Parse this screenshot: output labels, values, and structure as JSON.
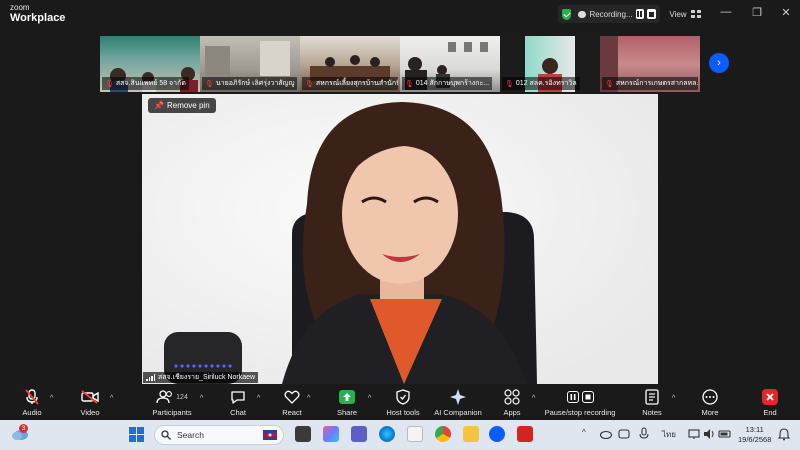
{
  "brand": {
    "line1": "zoom",
    "line2": "Workplace"
  },
  "recording": {
    "label": "Recording..."
  },
  "view": {
    "label": "View"
  },
  "thumbnails": [
    {
      "name": "สสจ.สินแพทย์ 58 จากัด"
    },
    {
      "name": "นายอภิรักษ์ เลิศรุ่งวาสัญญู"
    },
    {
      "name": "สหกรณ์เลี้ยงสุกรบ้านสำนักนี..."
    },
    {
      "name": "014 สักกาษบุพกร้างกะ..."
    },
    {
      "name": "012 สลค.รอิงทราวิล"
    },
    {
      "name": "สหกรณ์การเกษตรสากลหล..."
    }
  ],
  "main": {
    "remove_pin": "Remove pin",
    "speaker_name": "สสจ.เชียงราย_Siriluck Norkaew"
  },
  "toolbar": {
    "audio": "Audio",
    "video": "Video",
    "participants": "Participants",
    "participants_count": "124",
    "chat": "Chat",
    "react": "React",
    "share": "Share",
    "host_tools": "Host tools",
    "ai_companion": "AI Companion",
    "apps": "Apps",
    "pause_stop": "Pause/stop recording",
    "notes": "Notes",
    "more": "More",
    "end": "End"
  },
  "taskbar": {
    "search_placeholder": "Search",
    "weather_badge": "3",
    "language": "ไทย",
    "time": "13:11",
    "date": "19/6/2568"
  },
  "colors": {
    "accent": "#0b5cff",
    "share_green": "#23b24b",
    "end_red": "#e02828",
    "mic_off_red": "#ff3b3b"
  }
}
